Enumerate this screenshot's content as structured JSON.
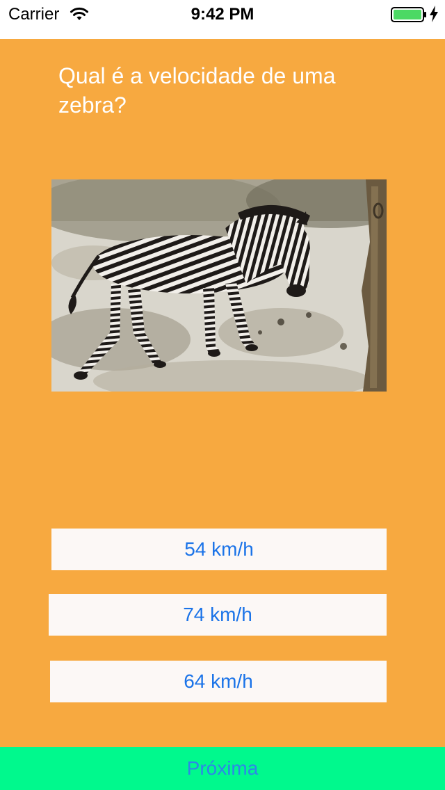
{
  "status_bar": {
    "carrier": "Carrier",
    "time": "9:42 PM",
    "battery_color": "#4CD964"
  },
  "quiz": {
    "question": "Qual é a velocidade de uma zebra?",
    "image_subject": "zebra",
    "answers": [
      "54 km/h",
      "74 km/h",
      "64 km/h"
    ],
    "next_label": "Próxima"
  },
  "colors": {
    "background": "#F7A940",
    "answer_bg": "#FCF8F6",
    "answer_text": "#1A73E8",
    "next_bg": "#00F98D",
    "next_text": "#2E86E8"
  }
}
